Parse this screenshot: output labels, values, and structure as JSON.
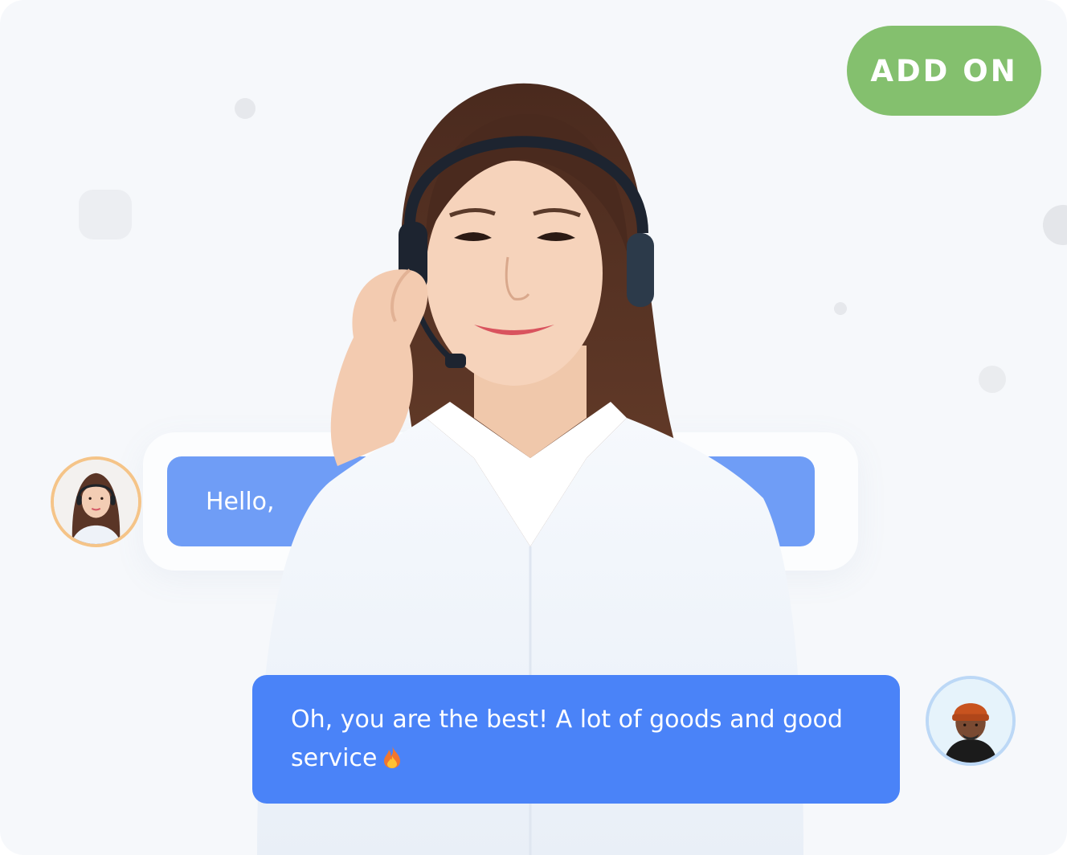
{
  "badge": {
    "label": "ADD ON",
    "color": "#84c06e"
  },
  "agent_message": {
    "text": "Hello,",
    "bubble_color": "#6f9df6"
  },
  "customer_message": {
    "text": "Oh, you are the best! A lot of goods and good service",
    "bubble_color": "#4a83f8",
    "icon": "fire-icon"
  },
  "avatars": {
    "agent": {
      "icon": "agent-avatar",
      "ring_color": "#f5c488"
    },
    "customer": {
      "icon": "customer-avatar",
      "ring_color": "#bcd8f6"
    }
  },
  "hero": {
    "icon": "support-agent-with-headset-photo"
  }
}
